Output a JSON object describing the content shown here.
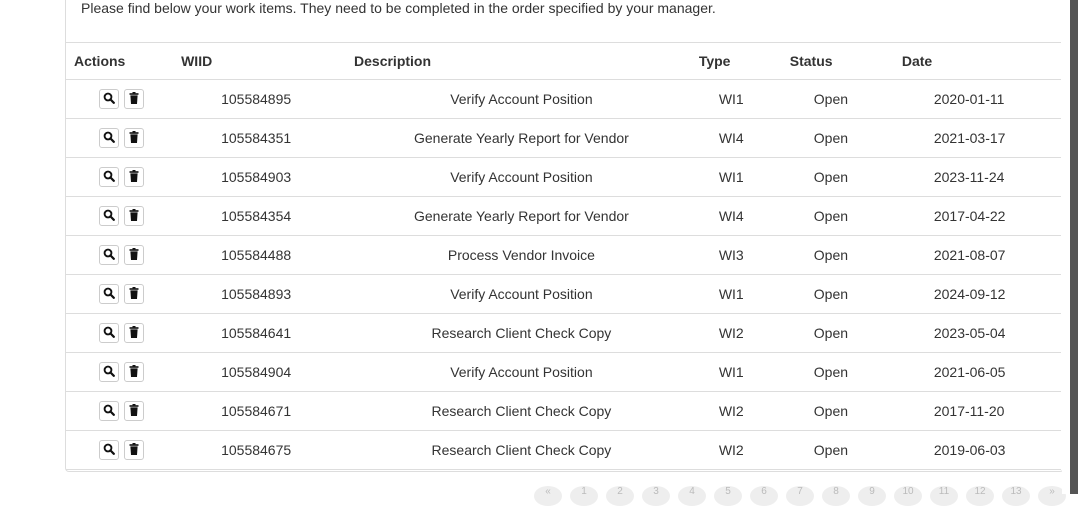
{
  "intro": "Please find below your work items. They need to be completed in the order specified by your manager.",
  "table": {
    "headers": {
      "actions": "Actions",
      "wiid": "WIID",
      "description": "Description",
      "type": "Type",
      "status": "Status",
      "date": "Date"
    },
    "rows": [
      {
        "wiid": "105584895",
        "description": "Verify Account Position",
        "type": "WI1",
        "status": "Open",
        "date": "2020-01-11"
      },
      {
        "wiid": "105584351",
        "description": "Generate Yearly Report for Vendor",
        "type": "WI4",
        "status": "Open",
        "date": "2021-03-17"
      },
      {
        "wiid": "105584903",
        "description": "Verify Account Position",
        "type": "WI1",
        "status": "Open",
        "date": "2023-11-24"
      },
      {
        "wiid": "105584354",
        "description": "Generate Yearly Report for Vendor",
        "type": "WI4",
        "status": "Open",
        "date": "2017-04-22"
      },
      {
        "wiid": "105584488",
        "description": "Process Vendor Invoice",
        "type": "WI3",
        "status": "Open",
        "date": "2021-08-07"
      },
      {
        "wiid": "105584893",
        "description": "Verify Account Position",
        "type": "WI1",
        "status": "Open",
        "date": "2024-09-12"
      },
      {
        "wiid": "105584641",
        "description": "Research Client Check Copy",
        "type": "WI2",
        "status": "Open",
        "date": "2023-05-04"
      },
      {
        "wiid": "105584904",
        "description": "Verify Account Position",
        "type": "WI1",
        "status": "Open",
        "date": "2021-06-05"
      },
      {
        "wiid": "105584671",
        "description": "Research Client Check Copy",
        "type": "WI2",
        "status": "Open",
        "date": "2017-11-20"
      },
      {
        "wiid": "105584675",
        "description": "Research Client Check Copy",
        "type": "WI2",
        "status": "Open",
        "date": "2019-06-03"
      }
    ]
  },
  "row_actions": {
    "view_icon": "search-icon",
    "delete_icon": "trash-icon"
  },
  "pagination": {
    "pages": [
      "«",
      "1",
      "2",
      "3",
      "4",
      "5",
      "6",
      "7",
      "8",
      "9",
      "10",
      "11",
      "12",
      "13",
      "»"
    ]
  }
}
